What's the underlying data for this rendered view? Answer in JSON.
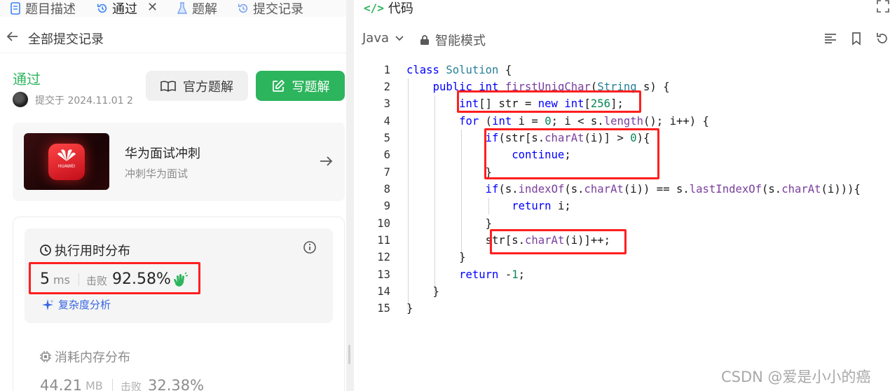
{
  "left": {
    "tabs": [
      {
        "label": "题目描述",
        "icon": "document-icon"
      },
      {
        "label": "通过",
        "icon": "history-icon"
      },
      {
        "label": "题解",
        "icon": "flask-icon"
      },
      {
        "label": "提交记录",
        "icon": "history-icon"
      }
    ],
    "back_label": "全部提交记录",
    "status": "通过",
    "submitted_text": "提交于 2024.11.01 2",
    "official_solution": "官方题解",
    "write_solution": "写题解",
    "promo": {
      "title": "华为面试冲刺",
      "subtitle": "冲刺华为面试",
      "logo_text": "HUAWEI"
    },
    "runtime": {
      "title": "执行用时分布",
      "value": "5",
      "unit": "ms",
      "beat_label": "击败",
      "beat": "92.58%"
    },
    "complexity": "复杂度分析",
    "memory": {
      "title": "消耗内存分布",
      "value": "44.21",
      "unit": "MB",
      "beat_label": "击败",
      "beat": "32.38%"
    }
  },
  "right": {
    "header": "代码",
    "language": "Java",
    "mode": "智能模式",
    "line_numbers": [
      "1",
      "2",
      "3",
      "4",
      "5",
      "6",
      "7",
      "8",
      "9",
      "10",
      "11",
      "12",
      "13",
      "14",
      "15"
    ]
  },
  "watermark": "CSDN @爱是小小的癌",
  "colors": {
    "accent_green": "#2db55d",
    "highlight_red": "#ff1f1f",
    "link_blue": "#3766e4"
  }
}
